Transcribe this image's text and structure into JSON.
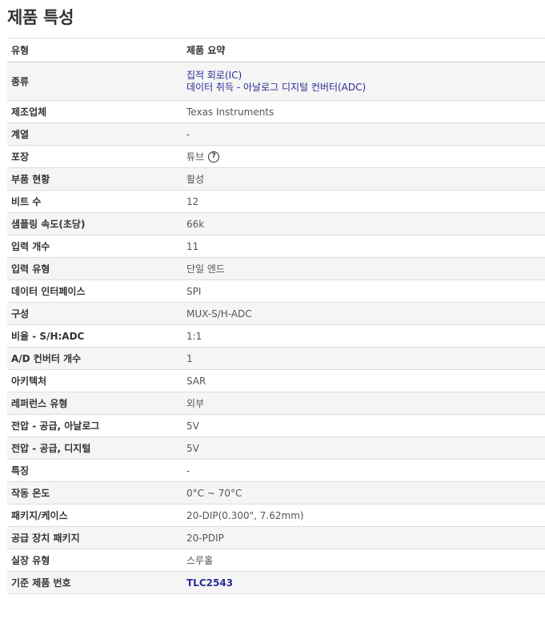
{
  "page": {
    "title": "제품 특성"
  },
  "table": {
    "header": {
      "label": "유형",
      "value": "제품 요약"
    },
    "rows": [
      {
        "label": "종류",
        "links": [
          "집적 회로(IC)",
          "데이터 취득 - 아날로그 디지털 컨버터(ADC)"
        ]
      },
      {
        "label": "제조업체",
        "value": "Texas Instruments"
      },
      {
        "label": "계열",
        "value": "-"
      },
      {
        "label": "포장",
        "value": "튜브",
        "help_icon": "?"
      },
      {
        "label": "부품 현황",
        "value": "활성"
      },
      {
        "label": "비트 수",
        "value": "12"
      },
      {
        "label": "샘플링 속도(초당)",
        "value": "66k"
      },
      {
        "label": "입력 개수",
        "value": "11"
      },
      {
        "label": "입력 유형",
        "value": "단일 엔드"
      },
      {
        "label": "데이터 인터페이스",
        "value": "SPI"
      },
      {
        "label": "구성",
        "value": "MUX-S/H-ADC"
      },
      {
        "label": "비율 - S/H:ADC",
        "value": "1:1"
      },
      {
        "label": "A/D 컨버터 개수",
        "value": "1"
      },
      {
        "label": "아키텍처",
        "value": "SAR"
      },
      {
        "label": "레퍼런스 유형",
        "value": "외부"
      },
      {
        "label": "전압 - 공급, 아날로그",
        "value": "5V"
      },
      {
        "label": "전압 - 공급, 디지털",
        "value": "5V"
      },
      {
        "label": "특징",
        "value": "-"
      },
      {
        "label": "작동 온도",
        "value": "0°C ~ 70°C"
      },
      {
        "label": "패키지/케이스",
        "value": "20-DIP(0.300\", 7.62mm)"
      },
      {
        "label": "공급 장치 패키지",
        "value": "20-PDIP"
      },
      {
        "label": "실장 유형",
        "value": "스루홀"
      },
      {
        "label": "기준 제품 번호",
        "link": "TLC2543"
      }
    ]
  },
  "colors": {
    "link": "#2c2c99",
    "alt_row_bg": "#f5f5f5",
    "border": "#dcdcdc",
    "label_text": "#333333",
    "value_text": "#555555"
  }
}
